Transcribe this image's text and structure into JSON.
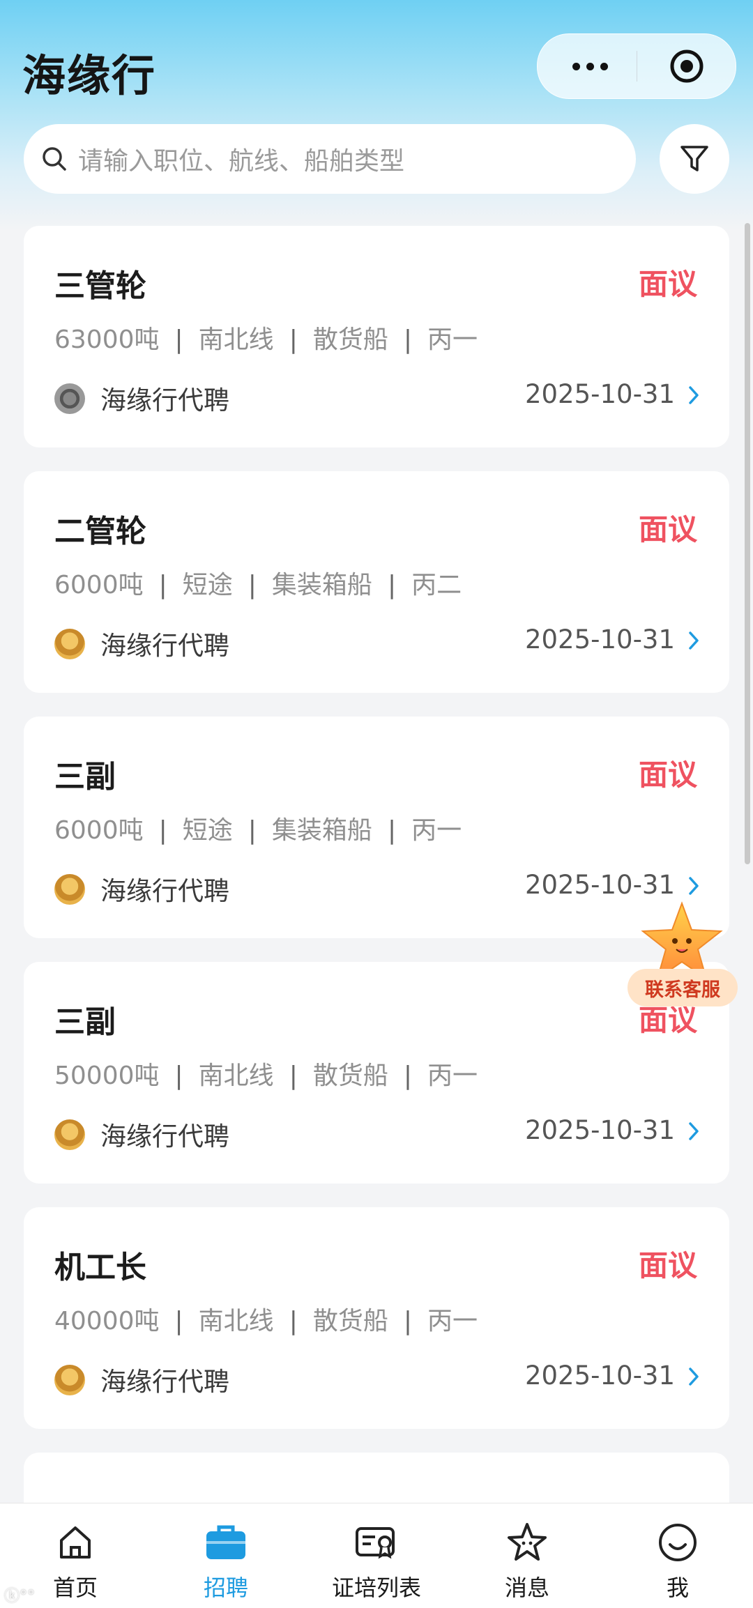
{
  "header": {
    "title": "海缘行",
    "search_placeholder": "请输入职位、航线、船舶类型"
  },
  "jobs": [
    {
      "title": "三管轮",
      "salary": "面议",
      "tags": [
        "63000吨",
        "南北线",
        "散货船",
        "丙一"
      ],
      "agent": "海缘行代聘",
      "date": "2025-10-31"
    },
    {
      "title": "二管轮",
      "salary": "面议",
      "tags": [
        "6000吨",
        "短途",
        "集装箱船",
        "丙二"
      ],
      "agent": "海缘行代聘",
      "date": "2025-10-31"
    },
    {
      "title": "三副",
      "salary": "面议",
      "tags": [
        "6000吨",
        "短途",
        "集装箱船",
        "丙一"
      ],
      "agent": "海缘行代聘",
      "date": "2025-10-31"
    },
    {
      "title": "三副",
      "salary": "面议",
      "tags": [
        "50000吨",
        "南北线",
        "散货船",
        "丙一"
      ],
      "agent": "海缘行代聘",
      "date": "2025-10-31"
    },
    {
      "title": "机工长",
      "salary": "面议",
      "tags": [
        "40000吨",
        "南北线",
        "散货船",
        "丙一"
      ],
      "agent": "海缘行代聘",
      "date": "2025-10-31"
    }
  ],
  "floating_service": {
    "label": "联系客服",
    "icon": "star-mascot-icon"
  },
  "tabbar": [
    {
      "label": "首页",
      "icon": "home-icon",
      "active": false
    },
    {
      "label": "招聘",
      "icon": "briefcase-icon",
      "active": true
    },
    {
      "label": "证培列表",
      "icon": "certificate-icon",
      "active": false
    },
    {
      "label": "消息",
      "icon": "star-icon",
      "active": false
    },
    {
      "label": "我",
      "icon": "smile-icon",
      "active": false
    }
  ],
  "colors": {
    "accent": "#1e9be0",
    "salary": "#ef5260"
  }
}
